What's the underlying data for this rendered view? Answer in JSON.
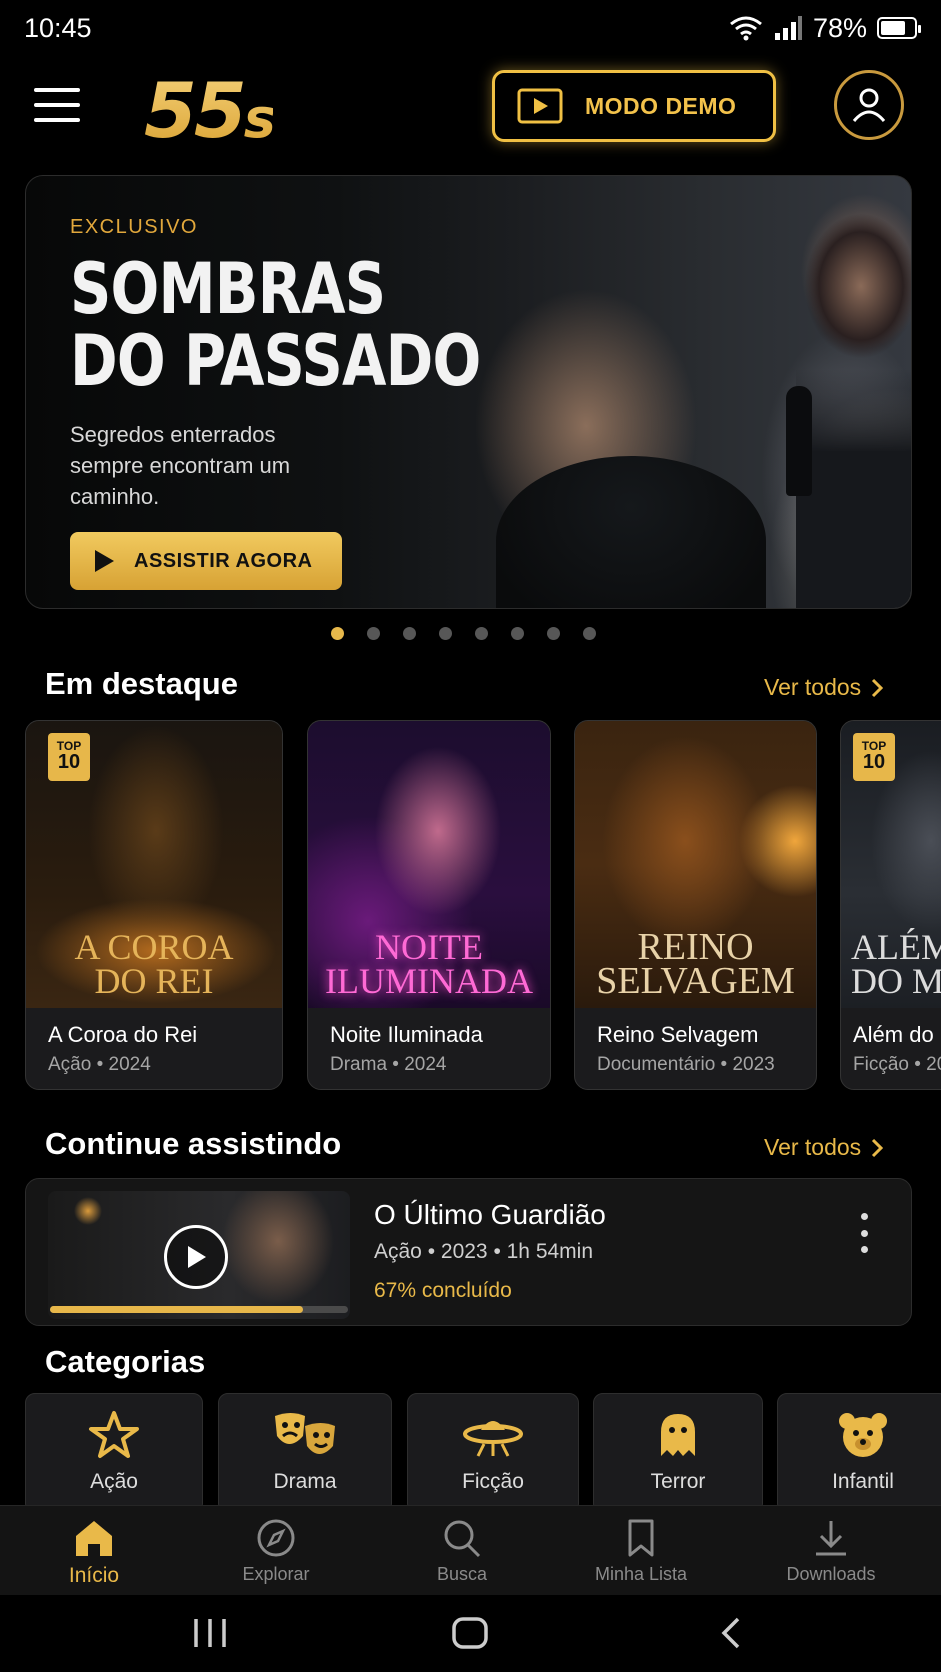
{
  "status_bar": {
    "time": "10:45",
    "battery": "78%",
    "battery_level": 0.78
  },
  "header": {
    "logo": "55",
    "logo_suffix": "s",
    "demo_label": "MODO DEMO"
  },
  "hero": {
    "kicker": "EXCLUSIVO",
    "title_line1": "SOMBRAS",
    "title_line2": "DO PASSADO",
    "description": "Segredos enterrados sempre encontram um caminho.",
    "cta": "ASSISTIR AGORA",
    "slides": 8,
    "active_slide": 1
  },
  "featured": {
    "title": "Em destaque",
    "see_all": "Ver todos",
    "items": [
      {
        "art_line1": "A COROA",
        "art_line2": "DO REI",
        "name": "A Coroa do Rei",
        "meta": "Ação • 2024",
        "badge_top": "TOP",
        "badge_num": "10"
      },
      {
        "art_line1": "NOITE",
        "art_line2": "ILUMINADA",
        "name": "Noite Iluminada",
        "meta": "Drama • 2024"
      },
      {
        "art_line1": "REINO",
        "art_line2": "SELVAGEM",
        "name": "Reino Selvagem",
        "meta": "Documentário • 2023"
      },
      {
        "art_line1": "ALÉM",
        "art_line2": "DO M",
        "name": "Além do M",
        "meta": "Ficção • 20",
        "badge_top": "TOP",
        "badge_num": "10"
      }
    ]
  },
  "continue_watching": {
    "title": "Continue assistindo",
    "see_all": "Ver todos",
    "item": {
      "title": "O Último Guardião",
      "meta": "Ação • 2023 • 1h 54min",
      "progress_label": "67% concluído",
      "progress": 0.85
    }
  },
  "categories": {
    "title": "Categorias",
    "items": [
      {
        "label": "Ação",
        "icon": "star-icon"
      },
      {
        "label": "Drama",
        "icon": "theater-masks-icon"
      },
      {
        "label": "Ficção",
        "icon": "ufo-icon"
      },
      {
        "label": "Terror",
        "icon": "ghost-icon"
      },
      {
        "label": "Infantil",
        "icon": "bear-icon"
      }
    ]
  },
  "bottom_nav": {
    "items": [
      {
        "label": "Início",
        "icon": "home-icon",
        "active": true
      },
      {
        "label": "Explorar",
        "icon": "compass-icon"
      },
      {
        "label": "Busca",
        "icon": "search-icon"
      },
      {
        "label": "Minha Lista",
        "icon": "bookmark-icon"
      },
      {
        "label": "Downloads",
        "icon": "download-icon"
      }
    ]
  },
  "colors": {
    "accent": "#E9B949",
    "background": "#000000",
    "card": "#1B1B1D"
  }
}
